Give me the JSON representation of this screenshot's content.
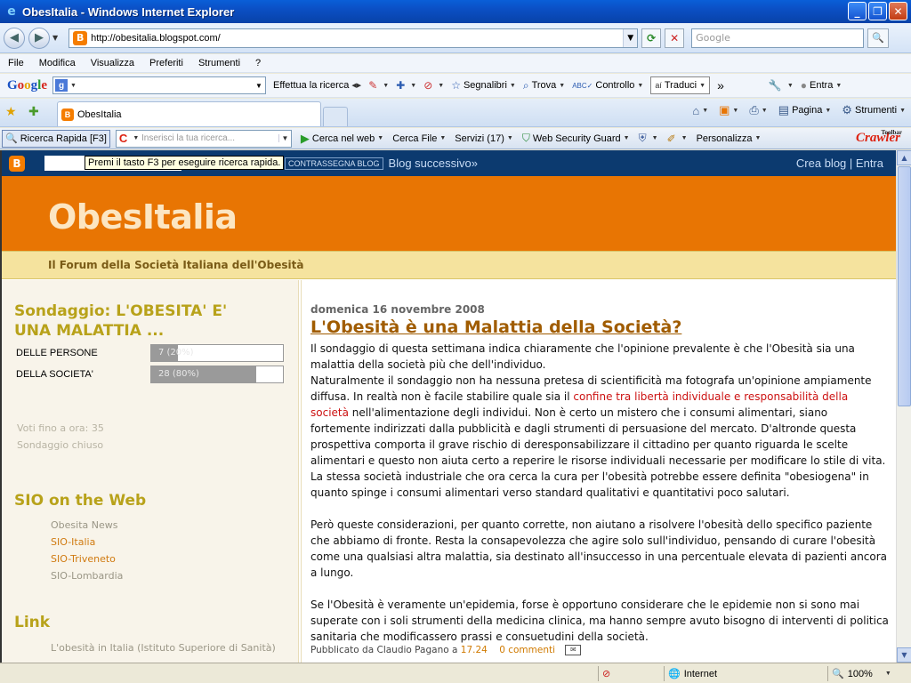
{
  "window": {
    "title": "ObesItalia - Windows Internet Explorer",
    "controls": {
      "minimize": "_",
      "maximize": "❐",
      "close": "✕"
    }
  },
  "address_bar": {
    "url": "http://obesitalia.blogspot.com/",
    "search_placeholder": "Google"
  },
  "menu": [
    "File",
    "Modifica",
    "Visualizza",
    "Preferiti",
    "Strumenti",
    "?"
  ],
  "google_toolbar": {
    "logo": [
      "G",
      "o",
      "o",
      "g",
      "l",
      "e"
    ],
    "search_label": "Effettua la ricerca",
    "segnalibri": "Segnalibri",
    "trova": "Trova",
    "controllo": "Controllo",
    "traduci": "Traduci",
    "more": "»",
    "entra": "Entra"
  },
  "tabs": {
    "active_tab": "ObesItalia",
    "pagina": "Pagina",
    "strumenti": "Strumenti"
  },
  "crawler_toolbar": {
    "rapid_search": "Ricerca Rapida [F3]",
    "search_placeholder": "Inserisci la tua ricerca...",
    "search_web": "Cerca nel web",
    "search_file": "Cerca File",
    "services": "Servizi (17)",
    "web_security": "Web Security Guard",
    "customize": "Personalizza",
    "logo": "Crawler",
    "logo_small": "Toolbar"
  },
  "blogger_nav": {
    "tooltip": "Premi il tasto F3 per eseguire ricerca rapida.",
    "flag": "CONTRASSEGNA BLOG",
    "next_blog": "Blog successivo»",
    "create_blog": "Crea blog",
    "separator": "|",
    "sign_in": "Entra"
  },
  "blog": {
    "title": "ObesItalia",
    "description": "Il Forum della Società Italiana dell'Obesità"
  },
  "sidebar": {
    "poll_title": "Sondaggio: L'OBESITA' E' UNA MALATTIA ...",
    "poll_title_line1": "Sondaggio: L'OBESITA' E'",
    "poll_title_line2": "UNA MALATTIA ...",
    "poll_options": [
      {
        "label": "DELLE PERSONE",
        "result": "7 (20%)",
        "percent": 20
      },
      {
        "label": "DELLA SOCIETA'",
        "result": "28 (80%)",
        "percent": 80
      }
    ],
    "votes": "Voti fino a ora: 35",
    "closed": "Sondaggio chiuso",
    "sio_title": "SIO on the Web",
    "sio_links": [
      "Obesita News",
      "SIO-Italia",
      "SIO-Triveneto",
      "SIO-Lombardia"
    ],
    "link_title": "Link",
    "links": [
      "L'obesità in Italia (Istituto Superiore di Sanità)"
    ]
  },
  "post": {
    "date": "domenica 16 novembre 2008",
    "title": "L'Obesità è una Malattia della Società?",
    "p1_a": "Il sondaggio di questa settimana indica chiaramente che l'opinione prevalente è che l'Obesità sia una malattia della società più che dell'individuo.",
    "p1_b": "Naturalmente il sondaggio non ha nessuna pretesa di scientificità ma fotografa un'opinione ampiamente diffusa. In realtà non è facile stabilire quale sia il ",
    "p1_red": "confine tra libertà individuale e responsabilità della società",
    "p1_c": " nell'alimentazione degli individui. Non è certo un mistero che i consumi alimentari, siano fortemente indirizzati dalla pubblicità e dagli strumenti di persuasione del mercato. D'altronde questa prospettiva comporta il grave rischio di deresponsabilizzare il cittadino per quanto riguarda le scelte alimentari e questo non aiuta certo a reperire le risorse individuali necessarie per modificare lo stile di vita.",
    "p1_d": "La stessa società industriale che ora cerca la cura per l'obesità potrebbe essere definita \"obesiogena\" in quanto spinge i consumi alimentari verso standard qualitativi e quantitativi poco salutari.",
    "p2": "Però queste considerazioni, per quanto corrette, non aiutano a risolvere l'obesità dello specifico paziente che abbiamo di fronte. Resta la consapevolezza che agire solo sull'individuo, pensando di curare l'obesità come una qualsiasi altra malattia, sia destinato all'insuccesso in una percentuale elevata di pazienti ancora a lungo.",
    "p3": "Se l'Obesità è veramente un'epidemia, forse è opportuno considerare che le epidemie non si sono mai superate con i soli strumenti della medicina clinica, ma hanno sempre avuto bisogno di interventi di politica sanitaria che modificassero prassi e consuetudini della società.",
    "footer_prefix": "Pubblicato da Claudio Pagano a",
    "time": "17.24",
    "comments": "0 commenti"
  },
  "status_bar": {
    "zone": "Internet",
    "zoom": "100%"
  },
  "colors": {
    "header_orange": "#e87503",
    "title_cream": "#fce6c2",
    "sidebar_heading": "#b8a21a",
    "post_title": "#a05c00",
    "highlight_red": "#cc1111",
    "blogger_nav": "#0c3a6f"
  }
}
